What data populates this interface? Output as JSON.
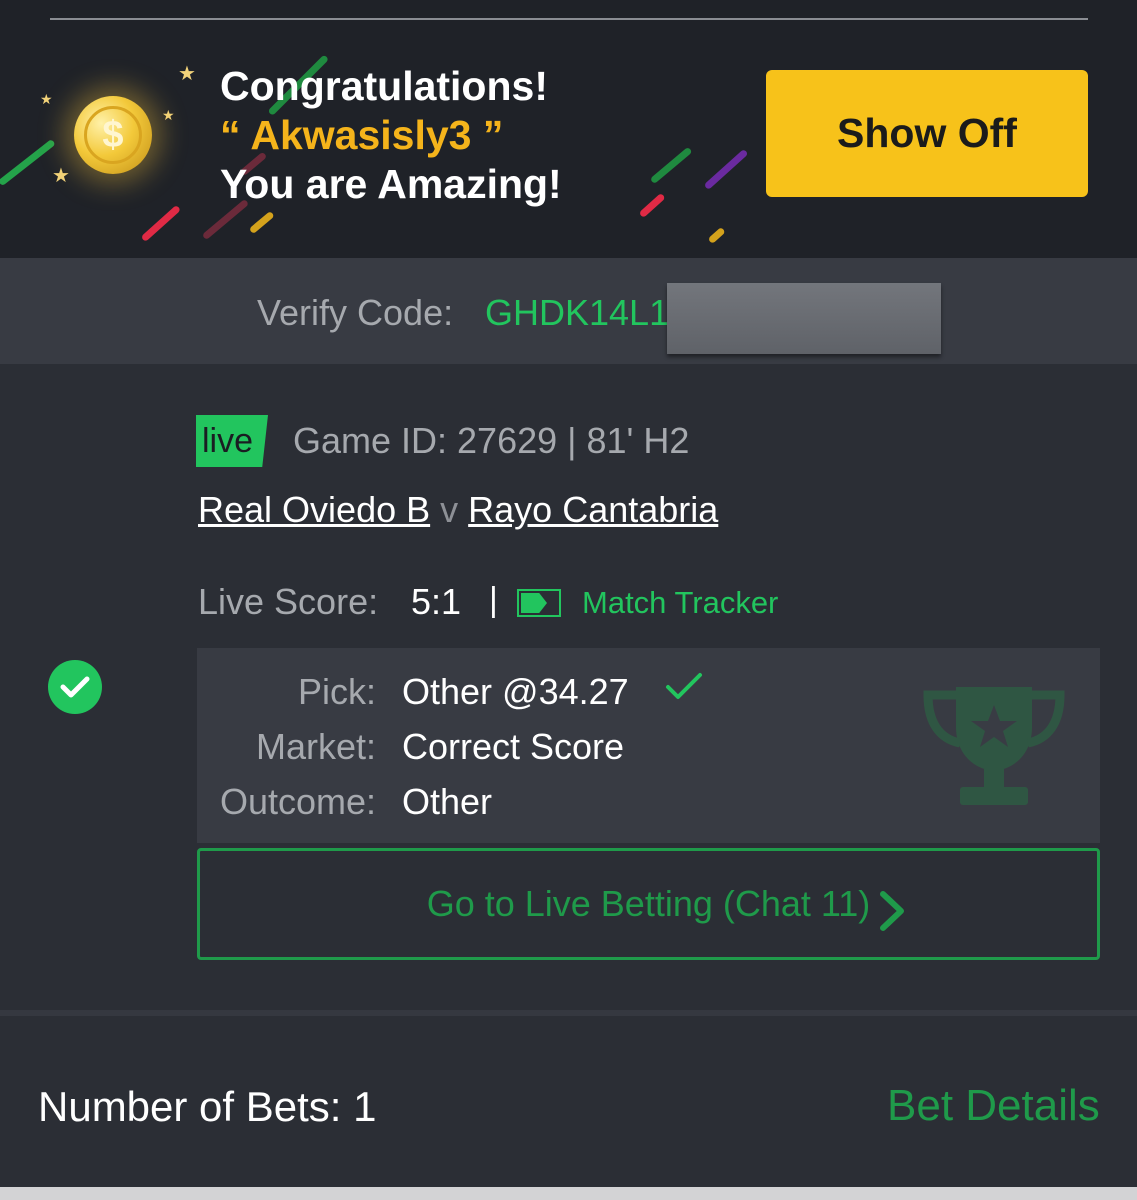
{
  "banner": {
    "line1": "Congratulations!",
    "username_open": "“ ",
    "username": "Akwasisly3",
    "username_close": " ”",
    "line3": "You are Amazing!",
    "show_off_label": "Show Off",
    "coin_icon": "dollar-coin-icon"
  },
  "verify": {
    "label": "Verify Code:",
    "code_visible": "GHDK14L1"
  },
  "game": {
    "live_tag": "live",
    "game_id_text": "Game ID: 27629 | 81' H2",
    "home_team": "Real Oviedo B",
    "vs": "v",
    "away_team": "Rayo Cantabria",
    "score_label": "Live Score:",
    "score": "5:1",
    "score_separator": "|",
    "tracker_label": "Match Tracker"
  },
  "pick": {
    "pick_label": "Pick:",
    "pick_value": "Other @34.27",
    "market_label": "Market:",
    "market_value": "Correct Score",
    "outcome_label": "Outcome:",
    "outcome_value": "Other",
    "status": "won"
  },
  "live_betting": {
    "label": "Go to Live Betting (Chat 11)"
  },
  "footer": {
    "bets_label": "Number of Bets: 1",
    "details_link": "Bet Details"
  },
  "colors": {
    "accent_green": "#22c55e",
    "gold": "#f5b41b",
    "button_yellow": "#f7c21a",
    "background": "#2b2e35"
  }
}
